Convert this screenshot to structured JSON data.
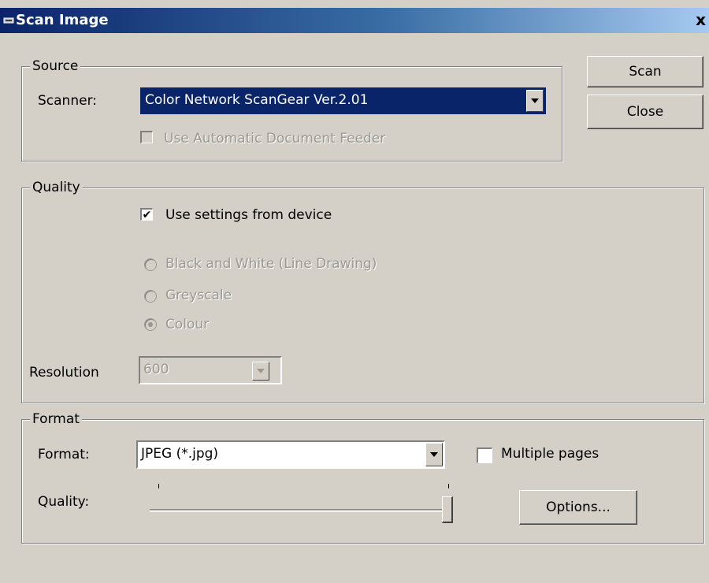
{
  "window": {
    "title": "Scan Image",
    "close_glyph": "x"
  },
  "buttons": {
    "scan": "Scan",
    "close": "Close",
    "options": "Options..."
  },
  "source": {
    "legend": "Source",
    "scanner_label": "Scanner:",
    "scanner_value": "Color Network ScanGear Ver.2.01",
    "adf_label": "Use Automatic Document Feeder",
    "adf_checked": false,
    "adf_enabled": false
  },
  "quality": {
    "legend": "Quality",
    "use_device_label": "Use settings from device",
    "use_device_checked": true,
    "radios": [
      {
        "label": "Black and White (Line Drawing)",
        "selected": false
      },
      {
        "label": "Greyscale",
        "selected": false
      },
      {
        "label": "Colour",
        "selected": true
      }
    ],
    "resolution_label": "Resolution",
    "resolution_value": "600"
  },
  "format": {
    "legend": "Format",
    "format_label": "Format:",
    "format_value": "JPEG (*.jpg)",
    "multiple_pages_label": "Multiple pages",
    "multiple_pages_checked": false,
    "quality_label": "Quality:",
    "quality_slider_level": 1.0
  },
  "colors": {
    "title_start": "#0a246a",
    "title_end": "#a6caf0",
    "selection": "#0a246a",
    "face": "#d4d0c8"
  }
}
